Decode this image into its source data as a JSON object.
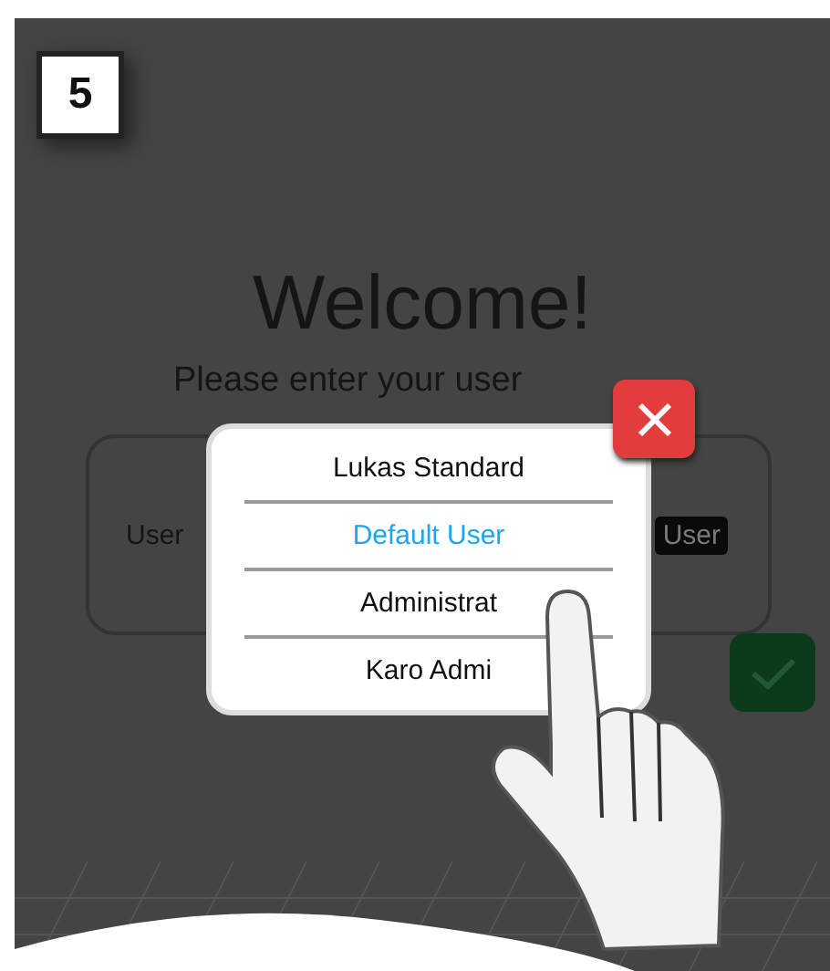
{
  "step_badge": "5",
  "heading": "Welcome!",
  "subtitle": "Please enter your user",
  "login_field": {
    "label": "User",
    "value": "User"
  },
  "user_menu": {
    "items": [
      {
        "label": "Lukas Standard",
        "selected": false
      },
      {
        "label": "Default User",
        "selected": true
      },
      {
        "label": "Administrat",
        "selected": false
      },
      {
        "label": "Karo Admi",
        "selected": false
      }
    ]
  }
}
